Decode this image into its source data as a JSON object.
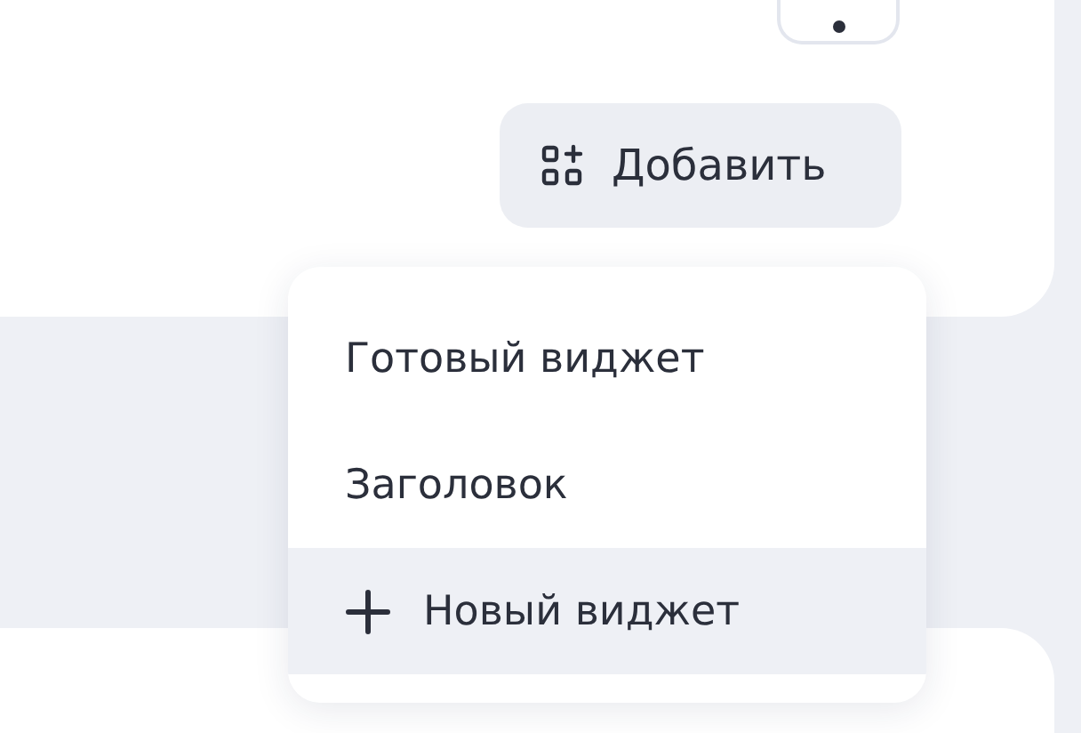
{
  "add_button": {
    "label": "Добавить"
  },
  "menu": {
    "items": [
      {
        "label": "Готовый виджет",
        "kind": "plain",
        "selected": false
      },
      {
        "label": "Заголовок",
        "kind": "plain",
        "selected": false
      },
      {
        "label": "Новый виджет",
        "kind": "create",
        "selected": true
      }
    ]
  }
}
